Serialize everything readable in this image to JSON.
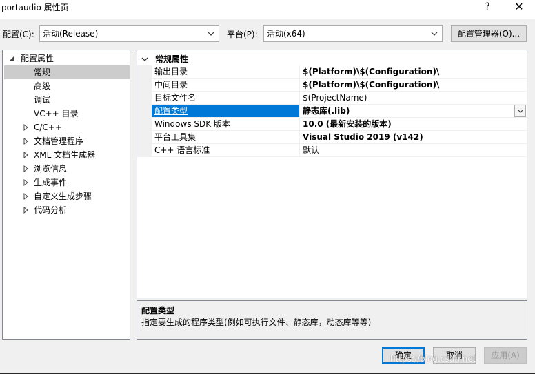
{
  "window": {
    "title": "portaudio 属性页",
    "help": "?",
    "close": "✕"
  },
  "config": {
    "config_label": "配置(C):",
    "config_value": "活动(Release)",
    "platform_label": "平台(P):",
    "platform_value": "活动(x64)",
    "manager_button": "配置管理器(O)..."
  },
  "tree": {
    "items": [
      {
        "label": "配置属性",
        "expander": "◢"
      },
      {
        "label": "常规"
      },
      {
        "label": "高级"
      },
      {
        "label": "调试"
      },
      {
        "label": "VC++ 目录"
      },
      {
        "label": "C/C++",
        "expander": "▷"
      },
      {
        "label": "文档管理程序",
        "expander": "▷"
      },
      {
        "label": "XML 文档生成器",
        "expander": "▷"
      },
      {
        "label": "浏览信息",
        "expander": "▷"
      },
      {
        "label": "生成事件",
        "expander": "▷"
      },
      {
        "label": "自定义生成步骤",
        "expander": "▷"
      },
      {
        "label": "代码分析",
        "expander": "▷"
      }
    ]
  },
  "grid": {
    "category": "常规属性",
    "category_expander": "⌄",
    "rows": [
      {
        "name": "输出目录",
        "value": "$(Platform)\\$(Configuration)\\"
      },
      {
        "name": "中间目录",
        "value": "$(Platform)\\$(Configuration)\\"
      },
      {
        "name": "目标文件名",
        "value": "$(ProjectName)"
      },
      {
        "name": "配置类型",
        "value": "静态库(.lib)"
      },
      {
        "name": "Windows SDK 版本",
        "value": "10.0 (最新安装的版本)"
      },
      {
        "name": "平台工具集",
        "value": "Visual Studio 2019 (v142)"
      },
      {
        "name": "C++ 语言标准",
        "value": "默认"
      }
    ]
  },
  "description": {
    "title": "配置类型",
    "text": "指定要生成的程序类型(例如可执行文件、静态库，动态库等等)"
  },
  "buttons": {
    "ok": "确定",
    "cancel": "取消",
    "apply": "应用(A)"
  },
  "watermark": "https://blog.csdn.net",
  "icons": {
    "chevron": "chevron-down-icon",
    "expand_collapsed": "triangle-right-icon",
    "expand_open": "triangle-down-icon"
  },
  "colors": {
    "selection": "#0078d7",
    "tree_selection": "#cccccc",
    "window_bg": "#f0f0f0"
  }
}
